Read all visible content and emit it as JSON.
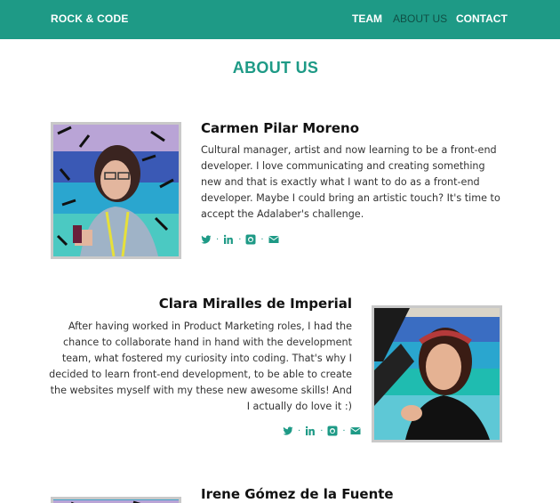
{
  "navbar": {
    "brand": "ROCK & CODE",
    "links": [
      {
        "label": "TEAM"
      },
      {
        "label": "ABOUT US"
      },
      {
        "label": "CONTACT"
      }
    ]
  },
  "page": {
    "title": "ABOUT US"
  },
  "members": [
    {
      "name": "Carmen Pilar Moreno",
      "bio_lines": [
        "Cultural manager, artist and now learning to be a front-end",
        "developer. I love communicating and creating something",
        "new and that is exactly what I want to do as a front-end",
        "developer. Maybe I could bring an artistic touch? It's time to",
        "accept the Adalaber's challenge."
      ],
      "socials": [
        "twitter-icon",
        "linkedin-icon",
        "github-icon",
        "email-icon"
      ]
    },
    {
      "name": "Clara Miralles de Imperial",
      "bio_lines": [
        "After having worked in Product Marketing roles, I had the",
        "chance to collaborate hand in hand with the development",
        "team, what fostered my curiosity into coding. That's why I",
        "decided to learn front-end development, to be able to create",
        "the websites myself with my these new awesome skills! And",
        "I actually do love it :)"
      ],
      "socials": [
        "twitter-icon",
        "linkedin-icon",
        "github-icon",
        "email-icon"
      ]
    },
    {
      "name": "Irene Gómez de la Fuente"
    }
  ],
  "colors": {
    "accent": "#1e9a86",
    "nav_active": "#0f4f45",
    "photo_border": "#c9c9c9"
  }
}
